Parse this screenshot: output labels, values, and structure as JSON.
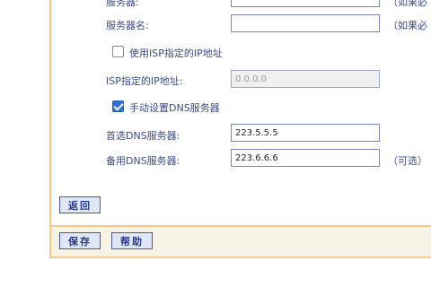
{
  "form": {
    "top_cut_label": "服务器:",
    "top_cut_note": "（如果必",
    "server_name_label": "服务器名:",
    "server_name_value": "",
    "server_name_note": "（如果必",
    "use_isp_ip_label": "使用ISP指定的IP地址",
    "isp_ip_label": "ISP指定的IP地址:",
    "isp_ip_value": "0.0.0.0",
    "manual_dns_label": "手动设置DNS服务器",
    "primary_dns_label": "首选DNS服务器:",
    "primary_dns_value": "223.5.5.5",
    "secondary_dns_label": "备用DNS服务器:",
    "secondary_dns_value": "223.6.6.6",
    "secondary_dns_note": "（可选）"
  },
  "buttons": {
    "back": "返回",
    "save": "保存",
    "help": "帮助"
  },
  "colors": {
    "border_accent": "#f2c98a",
    "label_text": "#3a4a8c",
    "button_bg": "#dfe6f5"
  }
}
